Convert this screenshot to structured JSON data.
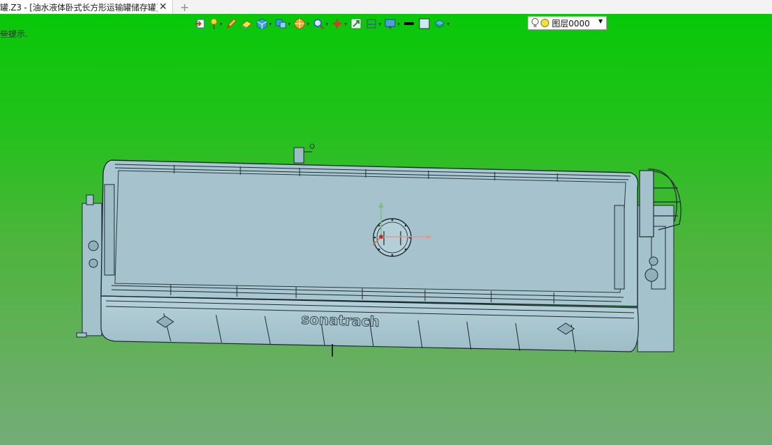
{
  "tab": {
    "title": "罐.Z3 - [油水液体卧式长方形运输罐储存罐]",
    "close_glyph": "✕",
    "add_glyph": "+"
  },
  "viewport": {
    "hint": "些提示.",
    "background_top": "#08c808",
    "background_bottom": "#73ad76"
  },
  "toolbar": {
    "tools": [
      {
        "icon": "exit-sketch-icon",
        "dropdown": false
      },
      {
        "icon": "pin-icon",
        "dropdown": true
      },
      {
        "icon": "pencil-icon",
        "dropdown": false
      },
      {
        "icon": "eraser-icon",
        "dropdown": false
      },
      {
        "icon": "cube-view-icon",
        "dropdown": true
      },
      {
        "icon": "display-mode-icon",
        "dropdown": true
      },
      {
        "icon": "render-sphere-icon",
        "dropdown": true
      },
      {
        "icon": "zoom-icon",
        "dropdown": true
      },
      {
        "icon": "pan-axis-icon",
        "dropdown": true
      },
      {
        "icon": "fit-view-icon",
        "dropdown": false
      },
      {
        "icon": "section-icon",
        "dropdown": true
      },
      {
        "icon": "monitor-icon",
        "dropdown": true
      },
      {
        "icon": "line-color-icon",
        "dropdown": false
      },
      {
        "icon": "fill-color-icon",
        "dropdown": false
      },
      {
        "icon": "layer-stack-icon",
        "dropdown": true
      }
    ],
    "layer": {
      "name": "图层0000",
      "bulb_icon": "lightbulb-icon",
      "status_color": "#f2e23a"
    }
  },
  "model": {
    "logo_text": "sonatrach",
    "body_color": "#a9c7d1",
    "edge_color": "#1c2a30"
  }
}
